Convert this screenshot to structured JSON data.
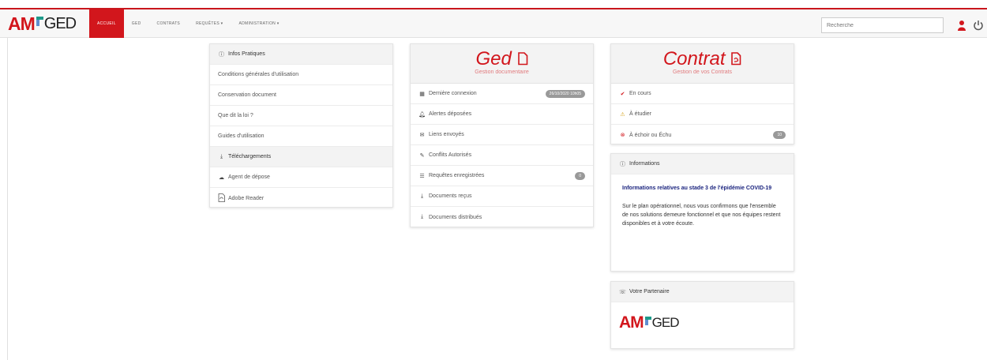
{
  "brand": {
    "logo_am": "AM",
    "logo_ged": "GED"
  },
  "nav": [
    {
      "label": "ACCUEIL",
      "active": true
    },
    {
      "label": "GED",
      "active": false
    },
    {
      "label": "CONTRATS",
      "active": false
    },
    {
      "label": "REQUÊTES ▾",
      "active": false
    },
    {
      "label": "ADMINISTRATION ▾",
      "active": false
    }
  ],
  "search": {
    "placeholder": "Recherche"
  },
  "infos": {
    "header": "Infos Pratiques",
    "items": [
      "Conditions générales d'utilisation",
      "Conservation document",
      "Que dit la loi ?",
      "Guides d'utilisation"
    ],
    "downloads_header": "Téléchargements",
    "downloads": [
      "Agent de dépose",
      "Adobe Reader"
    ]
  },
  "ged": {
    "title": "Ged",
    "subtitle": "Gestion documentaire",
    "items": [
      {
        "label": "Dernière connexion",
        "badge": "26/10/2020 10h05"
      },
      {
        "label": "Alertes déposées"
      },
      {
        "label": "Liens envoyés"
      },
      {
        "label": "Conflits Autorisés"
      },
      {
        "label": "Requêtes enregistrées",
        "badge": "0"
      },
      {
        "label": "Documents reçus"
      },
      {
        "label": "Documents distribués"
      }
    ]
  },
  "contrat": {
    "title": "Contrat",
    "subtitle": "Gestion de vos Contrats",
    "items": [
      {
        "label": "En cours"
      },
      {
        "label": "À étudier"
      },
      {
        "label": "À échoir ou Échu",
        "badge": "10"
      }
    ]
  },
  "informations": {
    "header": "Informations",
    "title": "Informations relatives au stade 3 de l'épidémie COVID-19",
    "text": "Sur le plan opérationnel, nous vous confirmons que l'ensemble de nos solutions demeure fonctionnel et que nos équipes restent disponibles et à votre écoute."
  },
  "partner": {
    "header": "Votre Partenaire",
    "logo_am": "AM",
    "logo_ged": "GED"
  },
  "colors": {
    "accent": "#d2161c",
    "logo_teal": "#1e9a8a",
    "logo_blue": "#5f8fd1"
  }
}
